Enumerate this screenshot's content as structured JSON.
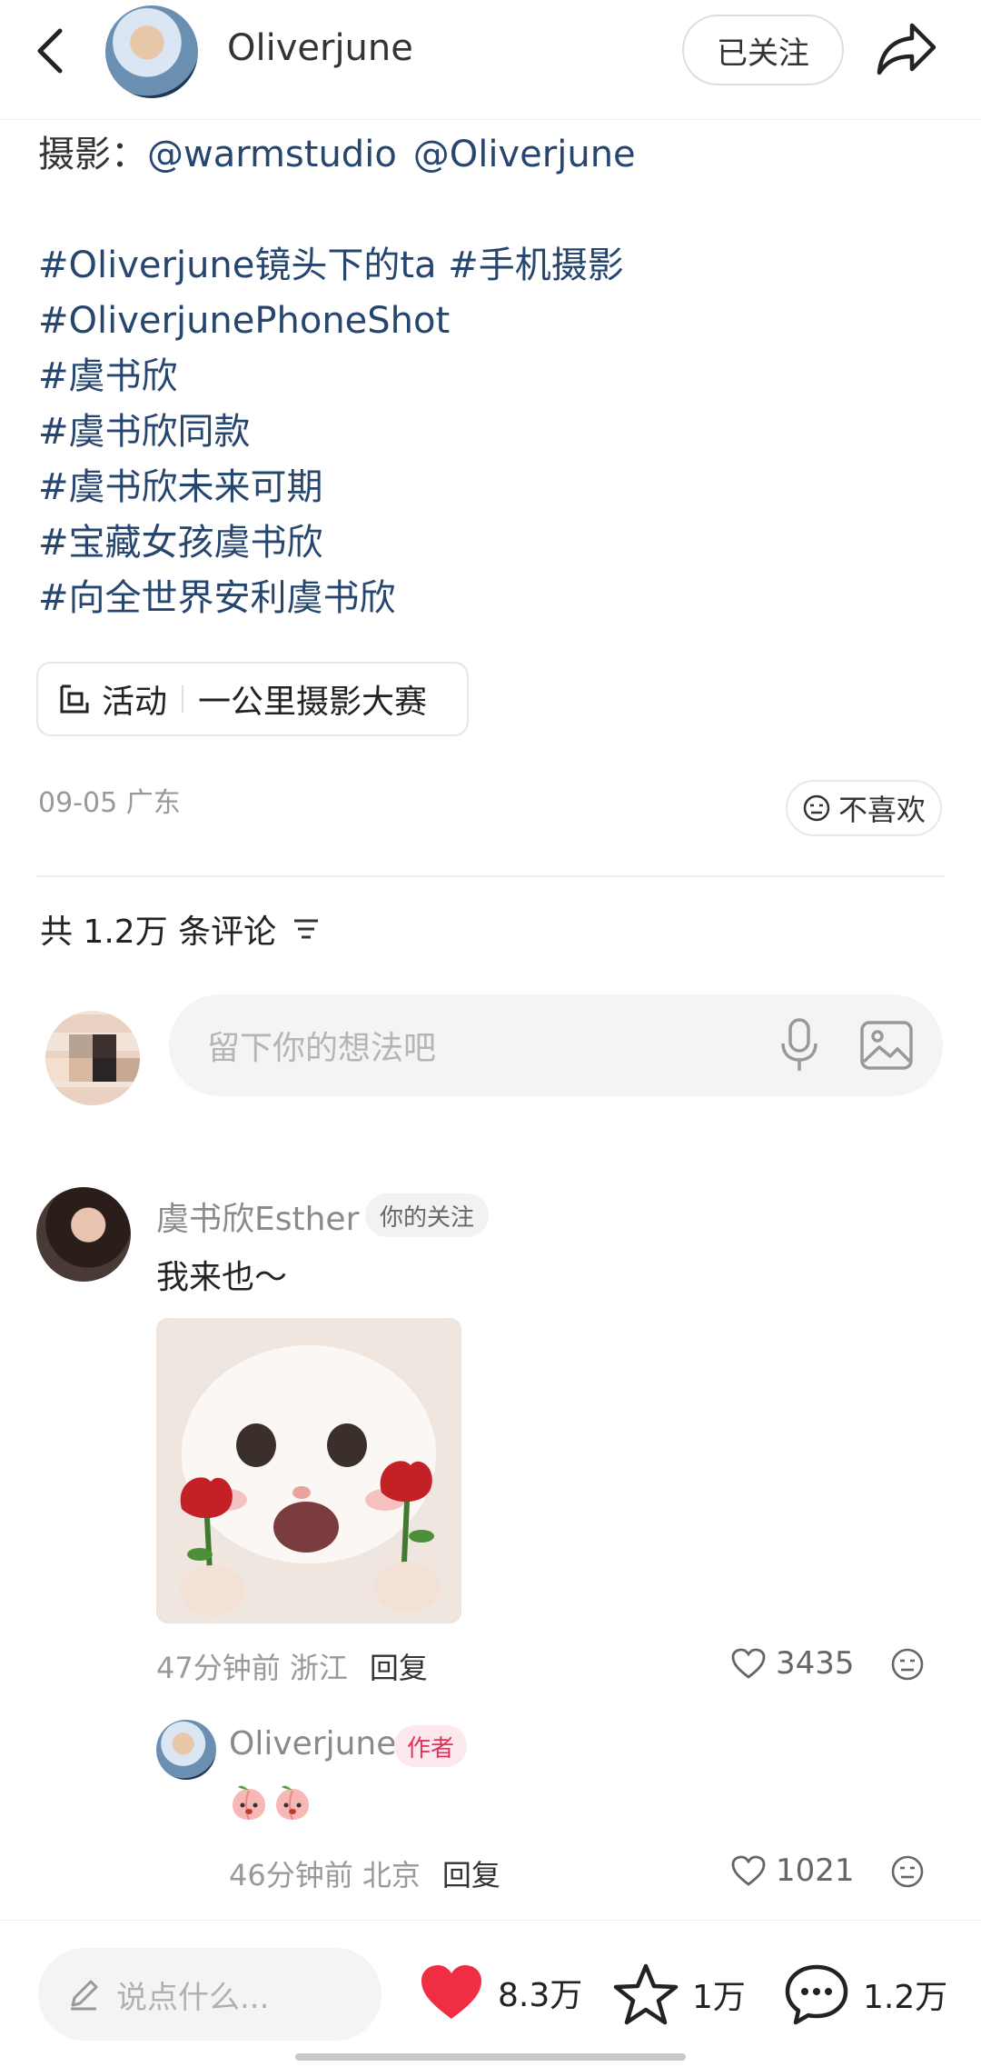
{
  "header": {
    "username": "Oliverjune",
    "follow_label": "已关注"
  },
  "post": {
    "credit_label": "摄影：",
    "mentions": [
      "@warmstudio",
      "@Oliverjune"
    ],
    "tags": [
      "#Oliverjune镜头下的ta #手机摄影",
      "#OliverjunePhoneShot",
      "#虞书欣",
      "#虞书欣同款",
      "#虞书欣未来可期",
      "#宝藏女孩虞书欣",
      "#向全世界安利虞书欣"
    ],
    "activity_label": "活动",
    "activity_name": "一公里摄影大赛",
    "date_location": "09-05 广东",
    "dislike_label": "不喜欢"
  },
  "comments_header": {
    "count_text": "共 1.2万 条评论"
  },
  "comment_input": {
    "placeholder": "留下你的想法吧"
  },
  "comment": {
    "author": "虞书欣Esther",
    "badge": "你的关注",
    "text": "我来也～",
    "time_location": "47分钟前 浙江",
    "reply_label": "回复",
    "likes": "3435"
  },
  "reply": {
    "author": "Oliverjune",
    "badge": "作者",
    "time_location": "46分钟前 北京",
    "reply_label": "回复",
    "likes": "1021"
  },
  "bottom_bar": {
    "say_placeholder": "说点什么...",
    "likes": "8.3万",
    "stars": "1万",
    "comments": "1.2万"
  },
  "colors": {
    "link": "#26466f",
    "like_red": "#f02e43",
    "author_badge": "#e0335a"
  }
}
